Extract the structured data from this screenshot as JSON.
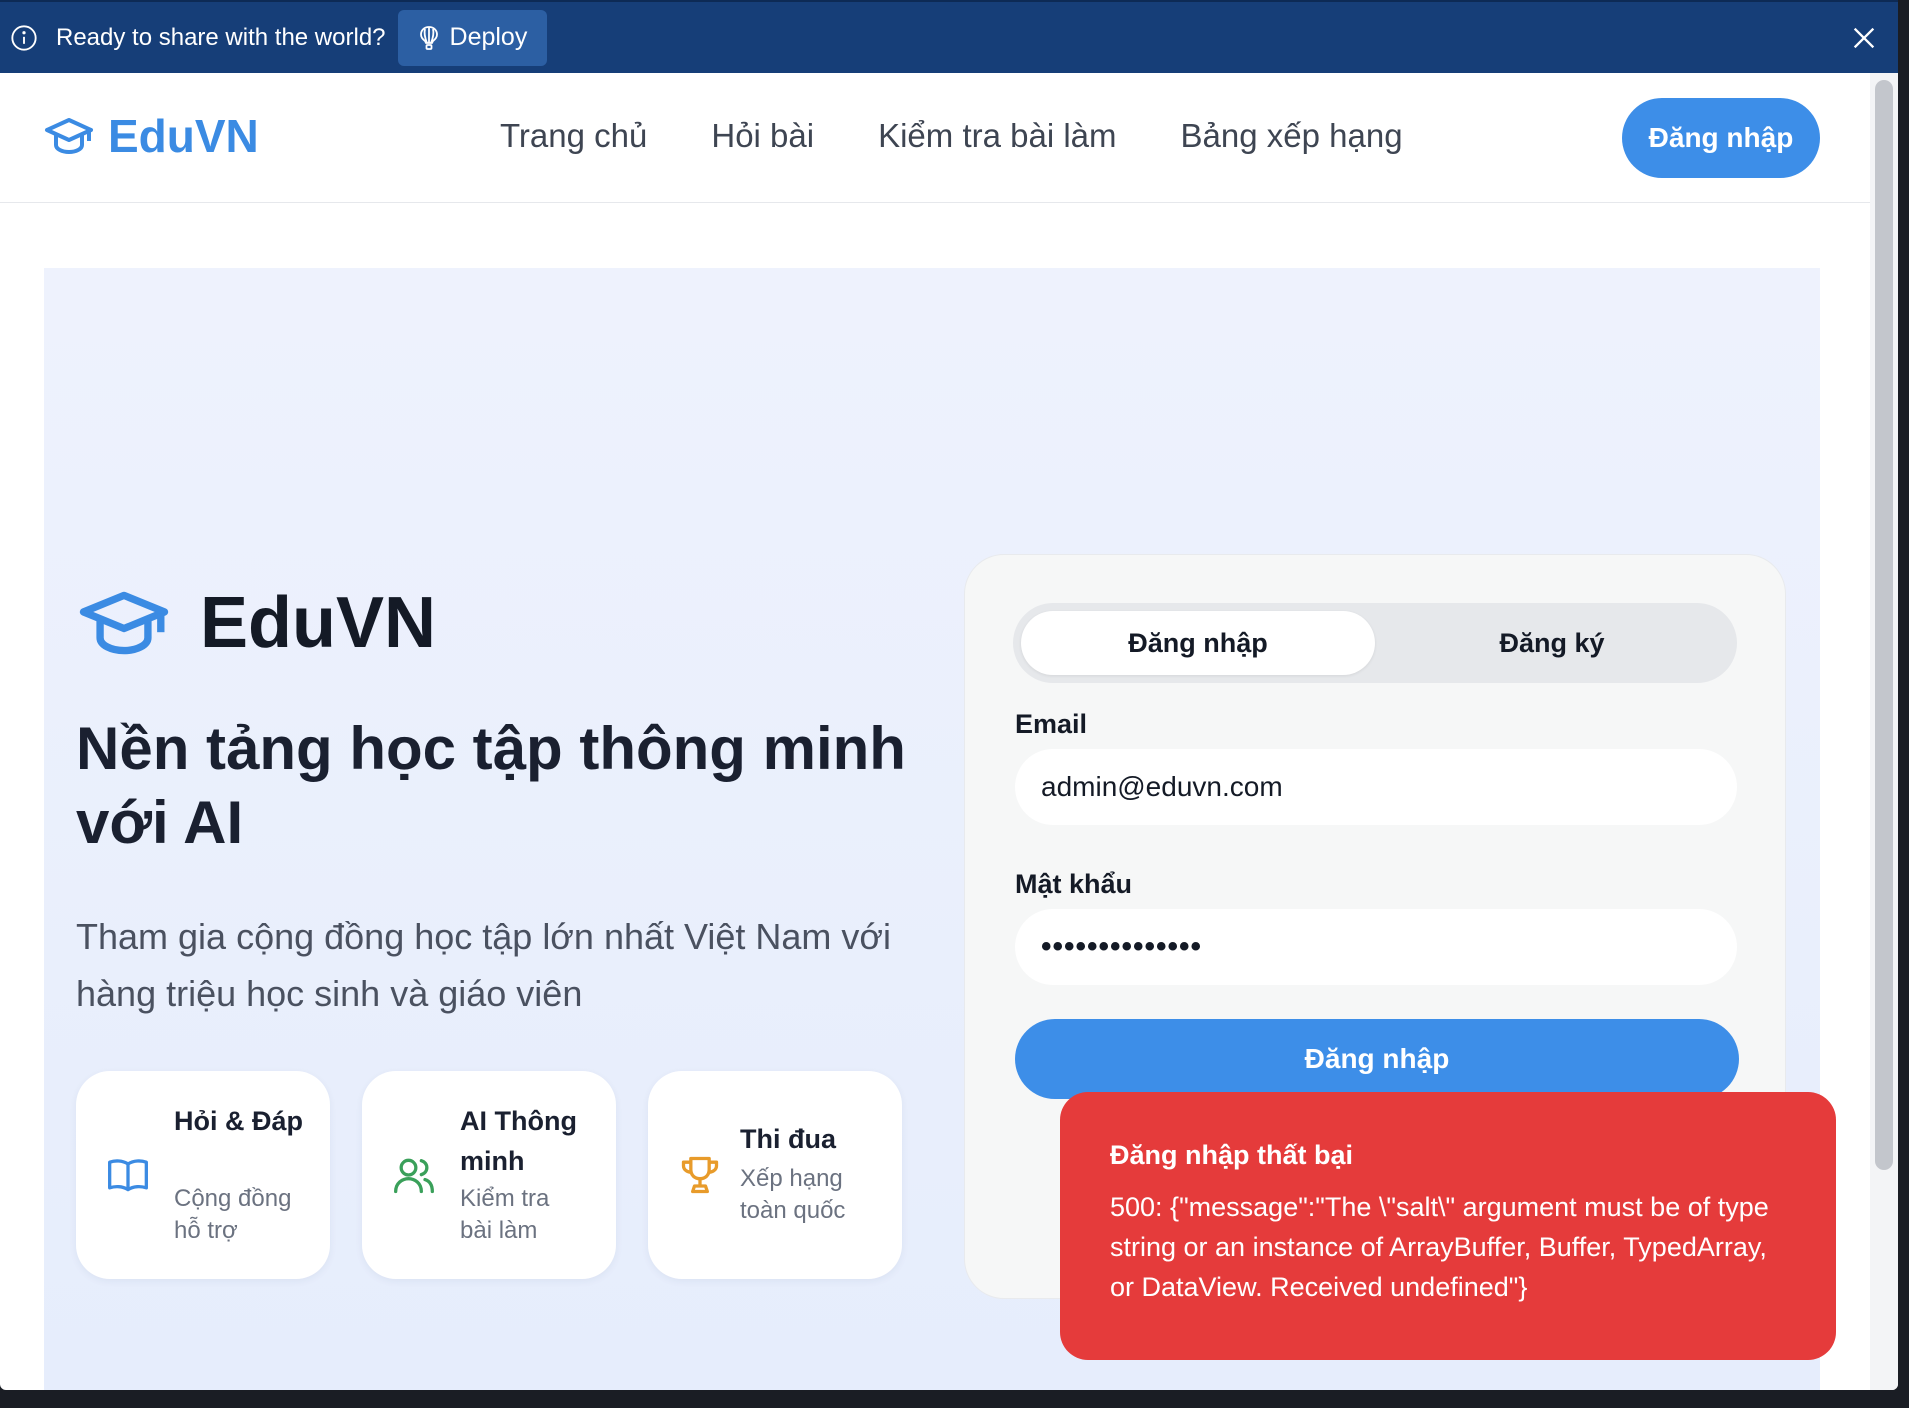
{
  "banner": {
    "text": "Ready to share with the world?",
    "deploy_label": "Deploy"
  },
  "nav": {
    "brand": "EduVN",
    "links": [
      "Trang chủ",
      "Hỏi bài",
      "Kiểm tra bài làm",
      "Bảng xếp hạng"
    ],
    "login_label": "Đăng nhập"
  },
  "hero": {
    "brand": "EduVN",
    "headline": "Nền tảng học tập thông minh với AI",
    "subtitle": "Tham gia cộng đồng học tập lớn nhất Việt Nam với hàng triệu học sinh và giáo viên",
    "features": [
      {
        "title": "Hỏi & Đáp",
        "subtitle": "Cộng đồng hỗ trợ",
        "icon": "book-icon",
        "color": "#3b8be3"
      },
      {
        "title": "AI Thông minh",
        "subtitle": "Kiểm tra bài làm",
        "icon": "users-icon",
        "color": "#3aa05a"
      },
      {
        "title": "Thi đua",
        "subtitle": "Xếp hạng toàn quốc",
        "icon": "trophy-icon",
        "color": "#e89b2a"
      }
    ]
  },
  "login_form": {
    "tab_login": "Đăng nhập",
    "tab_register": "Đăng ký",
    "email_label": "Email",
    "email_value": "admin@eduvn.com",
    "password_label": "Mật khẩu",
    "password_value": "••••••••••••••",
    "submit_label": "Đăng nhập"
  },
  "toast": {
    "title": "Đăng nhập thất bại",
    "message": "500: {\"message\":\"The \\\"salt\\\" argument must be of type string or an instance of ArrayBuffer, Buffer, TypedArray, or DataView. Received undefined\"}"
  },
  "colors": {
    "brand": "#3b8be3",
    "banner": "#163e78",
    "error": "#e53b3b"
  }
}
